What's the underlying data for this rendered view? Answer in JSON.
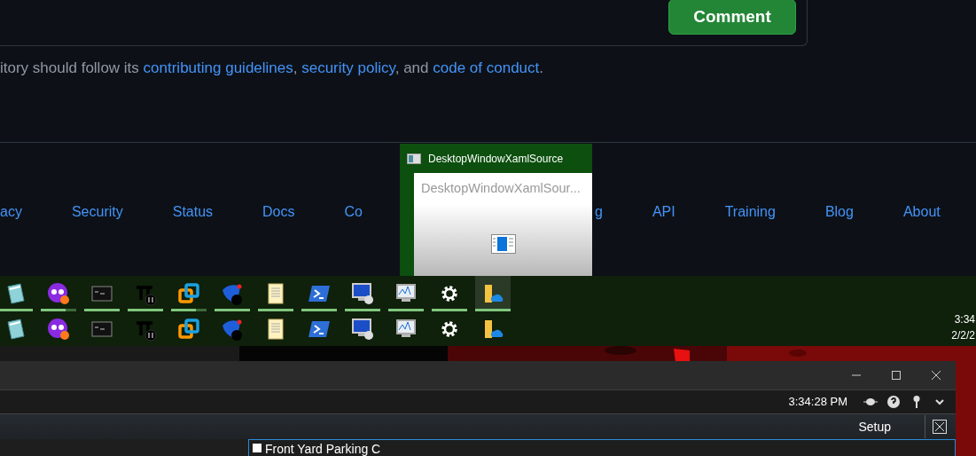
{
  "comment_box": {
    "button": "Comment"
  },
  "contributing": {
    "prefix": "itory should follow its ",
    "links": [
      "contributing guidelines",
      "security policy",
      "code of conduct"
    ],
    "separators": [
      ", ",
      ", and ",
      "."
    ]
  },
  "footer": {
    "links_before": [
      "acy",
      "Security",
      "Status",
      "Docs",
      "Co"
    ],
    "links_after": [
      "g",
      "API",
      "Training",
      "Blog",
      "About"
    ]
  },
  "thumbnail": {
    "title": "DesktopWindowXamlSource",
    "preview_title": "DesktopWindowXamlSour..."
  },
  "taskbar": {
    "rows": [
      {
        "apps": [
          {
            "kind": "notepad",
            "running": true,
            "multiple": false,
            "selected": false
          },
          {
            "kind": "mask",
            "running": true,
            "multiple": true,
            "selected": false
          },
          {
            "kind": "console",
            "running": true,
            "multiple": false,
            "selected": false
          },
          {
            "kind": "pi",
            "running": true,
            "multiple": false,
            "selected": false
          },
          {
            "kind": "squares",
            "running": true,
            "multiple": true,
            "selected": false
          },
          {
            "kind": "blob",
            "running": true,
            "multiple": false,
            "selected": false
          },
          {
            "kind": "scroll",
            "running": true,
            "multiple": false,
            "selected": false
          },
          {
            "kind": "prompt",
            "running": true,
            "multiple": false,
            "selected": false
          },
          {
            "kind": "computer",
            "running": true,
            "multiple": false,
            "selected": false
          },
          {
            "kind": "monitor",
            "running": true,
            "multiple": false,
            "selected": false
          },
          {
            "kind": "gear",
            "running": true,
            "multiple": false,
            "selected": false
          },
          {
            "kind": "folder",
            "running": true,
            "multiple": false,
            "selected": true
          }
        ]
      },
      {
        "apps": [
          {
            "kind": "notepad",
            "selected": false
          },
          {
            "kind": "mask",
            "selected": false
          },
          {
            "kind": "console",
            "selected": false
          },
          {
            "kind": "pi",
            "selected": false
          },
          {
            "kind": "squares",
            "selected": false
          },
          {
            "kind": "blob",
            "selected": false
          },
          {
            "kind": "scroll",
            "selected": false
          },
          {
            "kind": "prompt",
            "selected": false
          },
          {
            "kind": "computer",
            "selected": false
          },
          {
            "kind": "monitor",
            "selected": false
          },
          {
            "kind": "gear",
            "selected": false
          },
          {
            "kind": "folder",
            "selected": false
          }
        ]
      }
    ],
    "clock": {
      "time": "3:34",
      "date": "2/2/2"
    }
  },
  "app_window": {
    "time": "3:34:28 PM",
    "setup": "Setup",
    "view_title": "Front Yard Parking C"
  }
}
